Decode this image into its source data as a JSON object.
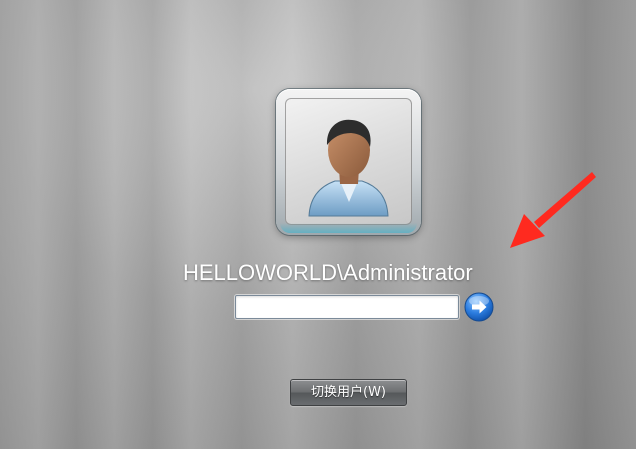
{
  "login": {
    "username": "HELLOWORLD\\Administrator",
    "password_value": "",
    "password_placeholder": "",
    "switch_user_label": "切换用户(W)"
  },
  "icons": {
    "avatar": "user-avatar-icon",
    "submit": "arrow-right-icon",
    "annotation": "red-arrow-icon"
  },
  "colors": {
    "background": "#a3a3a3",
    "submit_blue": "#1f6fd1",
    "annotation_red": "#ff2a1f"
  }
}
